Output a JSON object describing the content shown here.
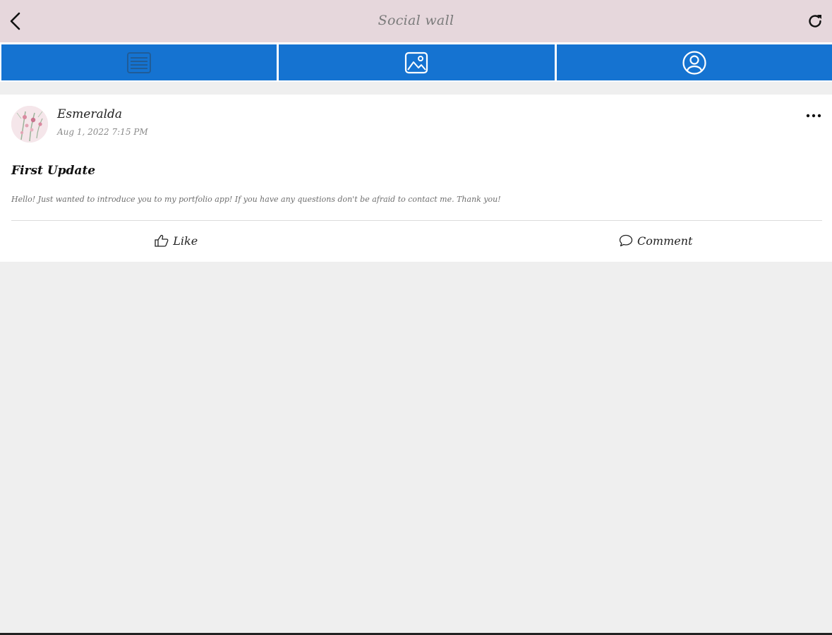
{
  "header": {
    "title": "Social wall"
  },
  "tabs": [
    {
      "icon": "list-icon",
      "selected": true
    },
    {
      "icon": "image-gallery-icon",
      "selected": false
    },
    {
      "icon": "user-profile-icon",
      "selected": false
    }
  ],
  "post": {
    "author": "Esmeralda",
    "timestamp": "Aug 1, 2022 7:15 PM",
    "title": "First Update",
    "body": "Hello! Just wanted to introduce you to my portfolio app! If you have any questions don't be afraid to contact me. Thank you!",
    "actions": {
      "like_label": "Like",
      "comment_label": "Comment"
    }
  },
  "colors": {
    "header_bg": "#e6d7dc",
    "tab_bg": "#1573d1",
    "page_bg": "#efefef"
  }
}
